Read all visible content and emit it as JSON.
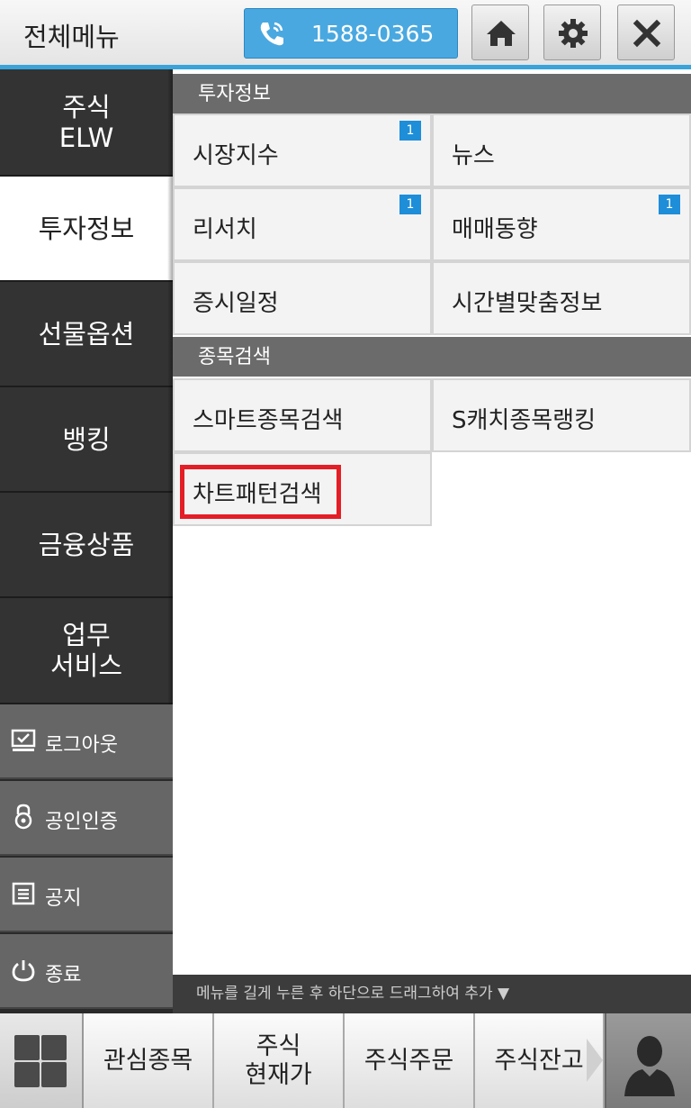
{
  "header": {
    "title": "전체메뉴",
    "phone": "1588-0365",
    "accent": "#3aa3d9"
  },
  "left_nav": {
    "items": [
      {
        "label": "주식\nELW"
      },
      {
        "label": "투자정보"
      },
      {
        "label": "선물옵션"
      },
      {
        "label": "뱅킹"
      },
      {
        "label": "금융상품"
      },
      {
        "label": "업무\n서비스"
      }
    ],
    "active_index": 1,
    "sub_items": [
      {
        "label": "로그아웃",
        "icon": "logout-icon"
      },
      {
        "label": "공인인증",
        "icon": "lock-icon"
      },
      {
        "label": "공지",
        "icon": "notice-icon"
      },
      {
        "label": "종료",
        "icon": "power-icon"
      }
    ]
  },
  "sections": [
    {
      "title": "투자정보",
      "items": [
        {
          "label": "시장지수",
          "badge": "1"
        },
        {
          "label": "뉴스",
          "badge": ""
        },
        {
          "label": "리서치",
          "badge": "1"
        },
        {
          "label": "매매동향",
          "badge": "1"
        },
        {
          "label": "증시일정",
          "badge": ""
        },
        {
          "label": "시간별맞춤정보",
          "badge": ""
        }
      ]
    },
    {
      "title": "종목검색",
      "items": [
        {
          "label": "스마트종목검색",
          "badge": ""
        },
        {
          "label": "S캐치종목랭킹",
          "badge": ""
        },
        {
          "label": "차트패턴검색",
          "badge": ""
        }
      ]
    }
  ],
  "drag_hint": "메뉴를 길게 누른 후 하단으로 드래그하여 추가 ▼",
  "bottom_bar": {
    "tabs": [
      {
        "label": "관심종목"
      },
      {
        "label": "주식\n현재가"
      },
      {
        "label": "주식주문"
      },
      {
        "label": "주식잔고"
      }
    ]
  },
  "colors": {
    "highlight": "#e41e26",
    "badge": "#1e8ed8",
    "section_bg": "#6b6b6b"
  }
}
